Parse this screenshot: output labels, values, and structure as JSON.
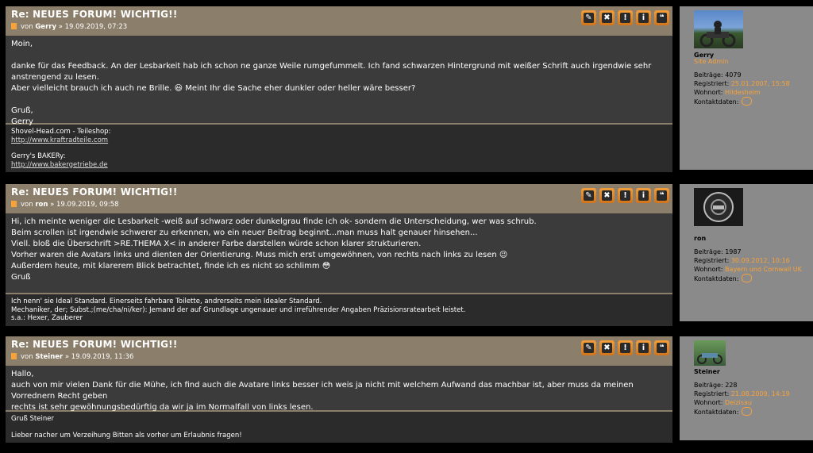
{
  "posts": [
    {
      "title": "Re: NEUES FORUM! WICHTIG!!",
      "byline_prefix": "von",
      "author": "Gerry",
      "byline_date": "» 19.09.2019, 07:23",
      "body": [
        "Moin,",
        "",
        "danke für das Feedback. An der Lesbarkeit hab ich schon ne ganze Weile rumgefummelt. Ich fand schwarzen Hintergrund mit weißer Schrift auch irgendwie sehr anstrengend zu lesen.",
        "Aber vielleicht brauch ich auch ne Brille. 😃 Meint Ihr die Sache eher dunkler oder heller wäre besser?",
        "",
        "Gruß,",
        "Gerry"
      ],
      "signature": [
        "Shovel-Head.com - Teileshop:",
        "http://www.kraftradteile.com",
        "",
        "Gerry's BAKERy:",
        "http://www.bakergetriebe.de"
      ],
      "user": {
        "name": "Gerry",
        "rank": "Site Admin",
        "posts_label": "Beiträge:",
        "posts": "4079",
        "registered_label": "Registriert:",
        "registered": "25.01.2007, 15:58",
        "location_label": "Wohnort:",
        "location": "Hildesheim",
        "contact_label": "Kontaktdaten:"
      }
    },
    {
      "title": "Re: NEUES FORUM! WICHTIG!!",
      "byline_prefix": "von",
      "author": "ron",
      "byline_date": "» 19.09.2019, 09:58",
      "body": [
        "Hi, ich meinte weniger die Lesbarkeit -weiß auf schwarz oder dunkelgrau finde ich ok- sondern die Unterscheidung, wer was schrub.",
        "Beim scrollen ist irgendwie schwerer zu erkennen, wo ein neuer Beitrag beginnt...man muss halt genauer hinsehen...",
        "Viell. bloß die Überschrift >RE.THEMA X< in anderer Farbe darstellen würde schon klarer strukturieren.",
        "Vorher waren die Avatars links und dienten der Orientierung. Muss mich erst umgewöhnen, von rechts nach links zu lesen 😉",
        "Außerdem heute, mit klarerem Blick betrachtet, finde ich es nicht so schlimm 😳",
        "Gruß"
      ],
      "signature": [
        "Ich nenn' sie Ideal Standard. Einerseits fahrbare Toilette, andrerseits mein Idealer Standard.",
        "Mechaniker, der; Subst.;(me/cha/ni/ker): Jemand der auf Grundlage ungenauer und irreführender Angaben Präzisionsratearbeit leistet.",
        "s.a.: Hexer, Zauberer"
      ],
      "user": {
        "name": "ron",
        "rank": "",
        "posts_label": "Beiträge:",
        "posts": "1987",
        "registered_label": "Registriert:",
        "registered": "30.09.2012, 10:16",
        "location_label": "Wohnort:",
        "location": "Bayern und Cornwall UK",
        "contact_label": "Kontaktdaten:"
      }
    },
    {
      "title": "Re: NEUES FORUM! WICHTIG!!",
      "byline_prefix": "von",
      "author": "Steiner",
      "byline_date": "» 19.09.2019, 11:36",
      "body": [
        "Hallo,",
        "auch von mir vielen Dank für die Mühe, ich find auch die Avatare links besser ich weis ja nicht mit welchem Aufwand das machbar ist, aber muss da meinen Vorrednern Recht geben",
        "rechts ist sehr gewöhnungsbedürftig da wir ja im Normalfall von links lesen."
      ],
      "signature": [
        "Gruß Steiner",
        "",
        "Lieber nacher um Verzeihung Bitten als vorher um Erlaubnis fragen!"
      ],
      "user": {
        "name": "Steiner",
        "rank": "",
        "posts_label": "Beiträge:",
        "posts": "228",
        "registered_label": "Registriert:",
        "registered": "21.08.2009, 14:19",
        "location_label": "Wohnort:",
        "location": "Deizisau",
        "contact_label": "Kontaktdaten:"
      }
    }
  ],
  "buttons": {
    "edit": "✎",
    "delete": "✖",
    "report": "!",
    "info": "i",
    "quote": "❝"
  },
  "colors": {
    "header": "#8b7e6a",
    "accent": "#f7a23a",
    "profile_bg": "#8a8a8a",
    "content_bg": "#3b3b3b"
  }
}
